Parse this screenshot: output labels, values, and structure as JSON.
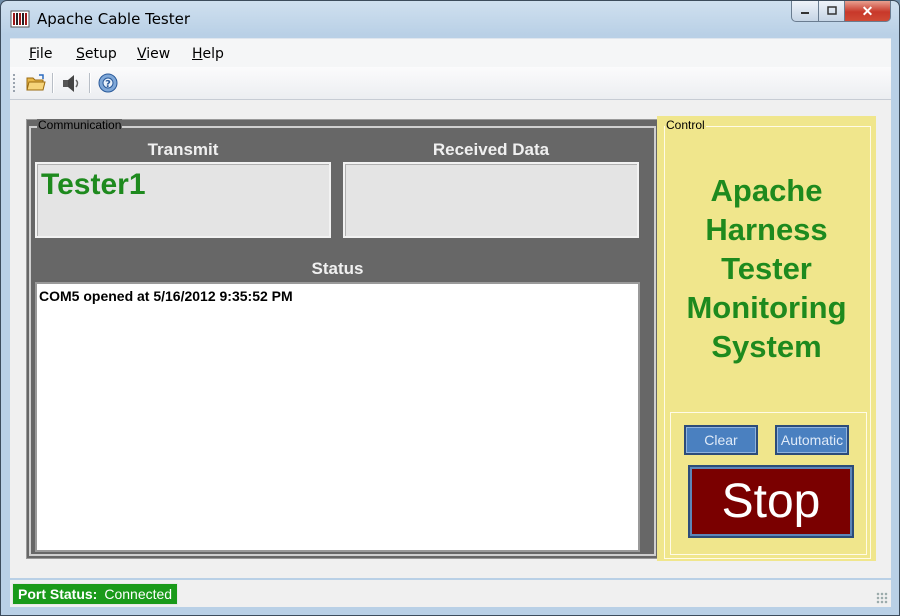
{
  "window": {
    "title": "Apache Cable Tester",
    "close_glyph": "✕"
  },
  "menu": [
    {
      "label": "File",
      "accel": "F",
      "rest": "ile"
    },
    {
      "label": "Setup",
      "accel": "S",
      "rest": "etup"
    },
    {
      "label": "View",
      "accel": "V",
      "rest": "iew"
    },
    {
      "label": "Help",
      "accel": "H",
      "rest": "elp"
    }
  ],
  "toolbar": {
    "icons": [
      "open-folder-icon",
      "speaker-icon",
      "help-icon"
    ]
  },
  "communication": {
    "legend": "Communication",
    "transmit_label": "Transmit",
    "transmit_value": "Tester1",
    "received_label": "Received Data",
    "received_value": "",
    "status_label": "Status",
    "status_lines": [
      "COM5 opened at 5/16/2012 9:35:52 PM"
    ]
  },
  "control": {
    "legend": "Control",
    "brand_lines": [
      "Apache",
      "Harness",
      "Tester",
      "Monitoring",
      "System"
    ],
    "clear_label": "Clear",
    "automatic_label": "Automatic",
    "stop_label": "Stop"
  },
  "statusbar": {
    "port_label": "Port Status:",
    "port_value": "Connected"
  },
  "colors": {
    "accent_green": "#1e8a1e",
    "stop_red": "#7a0000",
    "control_bg": "#f0e68c",
    "button_blue": "#4a80c0",
    "status_green": "#1a9a1a"
  }
}
